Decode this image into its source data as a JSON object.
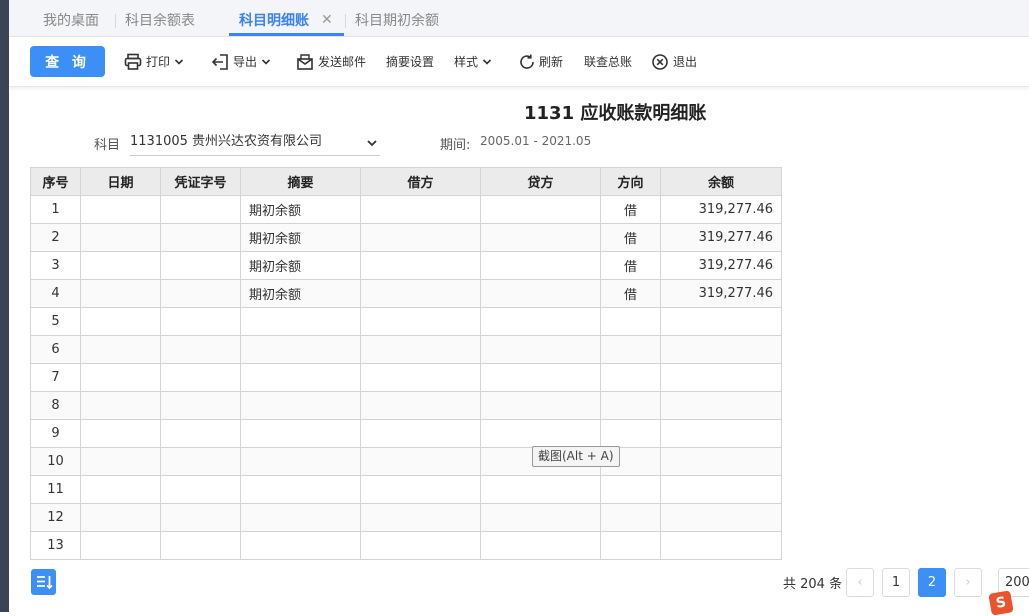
{
  "tabs": [
    {
      "label": "我的桌面"
    },
    {
      "label": "科目余额表"
    },
    {
      "label": "科目明细账"
    },
    {
      "label": "科目期初余额"
    }
  ],
  "toolbar": {
    "query_label": "查 询",
    "print_label": "打印",
    "export_label": "导出",
    "email_label": "发送邮件",
    "summary_settings_label": "摘要设置",
    "style_label": "样式",
    "refresh_label": "刷新",
    "ledger_link_label": "联查总账",
    "exit_label": "退出"
  },
  "report": {
    "title": "1131 应收账款明细账",
    "subject_label": "科目",
    "subject_value": "1131005 贵州兴达农资有限公司",
    "period_label": "期间:",
    "period_value": "2005.01 - 2021.05"
  },
  "table": {
    "headers": [
      "序号",
      "日期",
      "凭证字号",
      "摘要",
      "借方",
      "贷方",
      "方向",
      "余额"
    ],
    "rows": [
      {
        "seq": "1",
        "date": "",
        "voucher": "",
        "summary": "期初余额",
        "debit": "",
        "credit": "",
        "direction": "借",
        "balance": "319,277.46"
      },
      {
        "seq": "2",
        "date": "",
        "voucher": "",
        "summary": "期初余额",
        "debit": "",
        "credit": "",
        "direction": "借",
        "balance": "319,277.46"
      },
      {
        "seq": "3",
        "date": "",
        "voucher": "",
        "summary": "期初余额",
        "debit": "",
        "credit": "",
        "direction": "借",
        "balance": "319,277.46"
      },
      {
        "seq": "4",
        "date": "",
        "voucher": "",
        "summary": "期初余额",
        "debit": "",
        "credit": "",
        "direction": "借",
        "balance": "319,277.46"
      },
      {
        "seq": "5",
        "date": "",
        "voucher": "",
        "summary": "",
        "debit": "",
        "credit": "",
        "direction": "",
        "balance": ""
      },
      {
        "seq": "6",
        "date": "",
        "voucher": "",
        "summary": "",
        "debit": "",
        "credit": "",
        "direction": "",
        "balance": ""
      },
      {
        "seq": "7",
        "date": "",
        "voucher": "",
        "summary": "",
        "debit": "",
        "credit": "",
        "direction": "",
        "balance": ""
      },
      {
        "seq": "8",
        "date": "",
        "voucher": "",
        "summary": "",
        "debit": "",
        "credit": "",
        "direction": "",
        "balance": ""
      },
      {
        "seq": "9",
        "date": "",
        "voucher": "",
        "summary": "",
        "debit": "",
        "credit": "",
        "direction": "",
        "balance": ""
      },
      {
        "seq": "10",
        "date": "",
        "voucher": "",
        "summary": "",
        "debit": "",
        "credit": "",
        "direction": "",
        "balance": ""
      },
      {
        "seq": "11",
        "date": "",
        "voucher": "",
        "summary": "",
        "debit": "",
        "credit": "",
        "direction": "",
        "balance": ""
      },
      {
        "seq": "12",
        "date": "",
        "voucher": "",
        "summary": "",
        "debit": "",
        "credit": "",
        "direction": "",
        "balance": ""
      },
      {
        "seq": "13",
        "date": "",
        "voucher": "",
        "summary": "",
        "debit": "",
        "credit": "",
        "direction": "",
        "balance": ""
      }
    ]
  },
  "tooltip": "截图(Alt + A)",
  "pagination": {
    "total_text": "共 204 条",
    "prev": "‹",
    "pages": [
      "1",
      "2"
    ],
    "current_page": "2",
    "next": "›",
    "page_size": "200"
  },
  "colors": {
    "accent": "#3b8ff5",
    "sidebar": "#3a4454"
  }
}
